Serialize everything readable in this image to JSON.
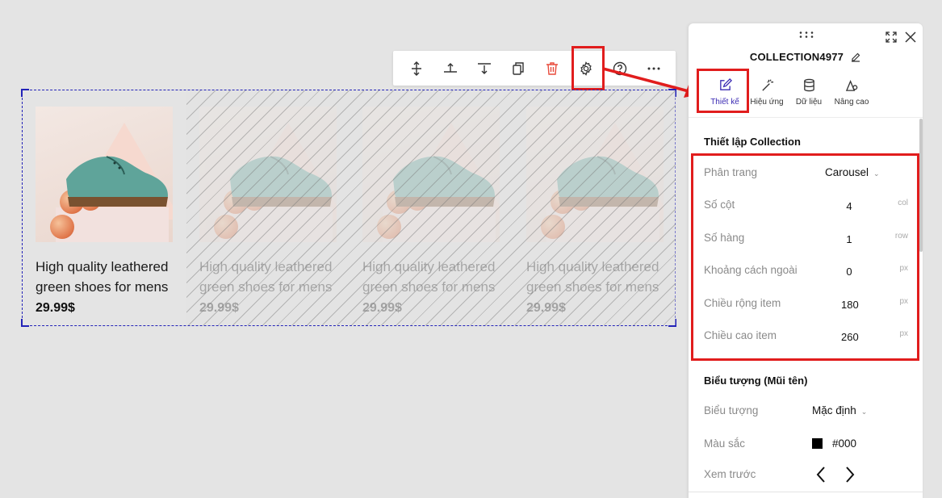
{
  "toolbar": {
    "buttons": [
      {
        "name": "move-icon"
      },
      {
        "name": "insert-above-icon"
      },
      {
        "name": "insert-below-icon"
      },
      {
        "name": "duplicate-icon"
      },
      {
        "name": "delete-icon",
        "color": "#e84b3c"
      },
      {
        "name": "gear-icon"
      },
      {
        "name": "help-icon"
      },
      {
        "name": "more-icon"
      }
    ]
  },
  "products": [
    {
      "title_line1": "High quality leathered",
      "title_line2": "green shoes for mens",
      "price": "29.99$"
    },
    {
      "title_line1": "High quality leathered",
      "title_line2": "green shoes for mens",
      "price": "29.99$"
    },
    {
      "title_line1": "High quality leathered",
      "title_line2": "green shoes for mens",
      "price": "29.99$"
    },
    {
      "title_line1": "High quality leathered",
      "title_line2": "green shoes for mens",
      "price": "29.99$"
    }
  ],
  "panel": {
    "title": "COLLECTION4977",
    "tabs": [
      {
        "label": "Thiết kế",
        "icon": "edit-icon",
        "active": true
      },
      {
        "label": "Hiệu ứng",
        "icon": "magic-wand-icon",
        "active": false
      },
      {
        "label": "Dữ liệu",
        "icon": "database-icon",
        "active": false
      },
      {
        "label": "Nâng cao",
        "icon": "advanced-settings-icon",
        "active": false
      }
    ],
    "collection_settings": {
      "title": "Thiết lập Collection",
      "pagination": {
        "label": "Phân trang",
        "value": "Carousel"
      },
      "columns": {
        "label": "Số cột",
        "value": "4",
        "unit": "col"
      },
      "rows": {
        "label": "Số hàng",
        "value": "1",
        "unit": "row"
      },
      "outer_spacing": {
        "label": "Khoảng cách ngoài",
        "value": "0",
        "unit": "px"
      },
      "item_width": {
        "label": "Chiều rộng item",
        "value": "180",
        "unit": "px"
      },
      "item_height": {
        "label": "Chiều cao item",
        "value": "260",
        "unit": "px"
      }
    },
    "arrow_settings": {
      "title": "Biểu tượng (Mũi tên)",
      "icon": {
        "label": "Biểu tượng",
        "value": "Mặc định"
      },
      "color": {
        "label": "Màu sắc",
        "value": "#000"
      },
      "preview": {
        "label": "Xem trước"
      }
    }
  },
  "colors": {
    "accent": "#3a2ab3",
    "highlight": "#e11d1d",
    "selection": "#2323b8"
  }
}
